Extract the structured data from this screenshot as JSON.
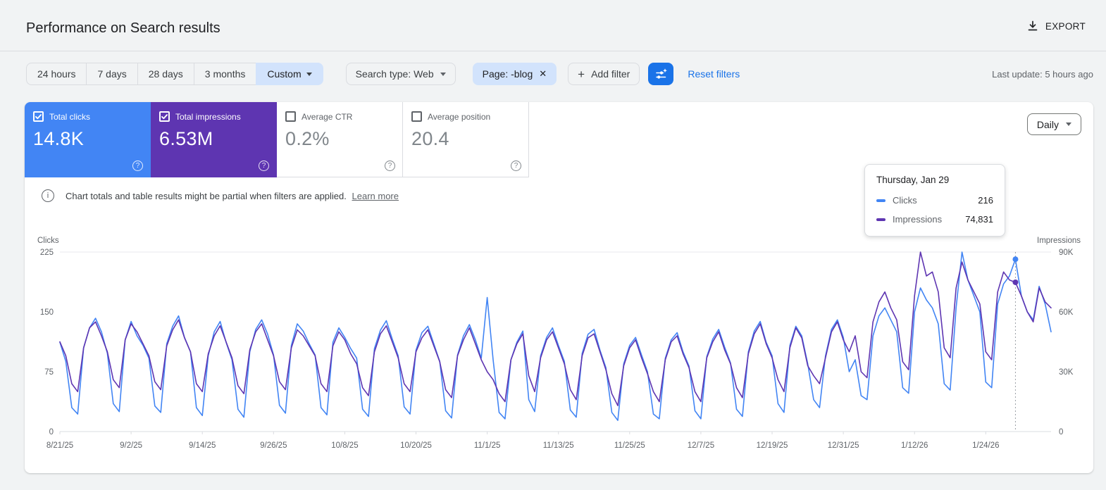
{
  "page": {
    "title": "Performance on Search results",
    "export_label": "EXPORT",
    "last_update": "Last update: 5 hours ago"
  },
  "icons": {
    "help": "?",
    "info": "i",
    "close": "✕",
    "plus": "+"
  },
  "filters": {
    "ranges": [
      {
        "label": "24 hours",
        "selected": false
      },
      {
        "label": "7 days",
        "selected": false
      },
      {
        "label": "28 days",
        "selected": false
      },
      {
        "label": "3 months",
        "selected": false
      },
      {
        "label": "Custom",
        "selected": true
      }
    ],
    "search_type": "Search type: Web",
    "page_filter": "Page: -blog",
    "add_filter": "Add filter",
    "reset": "Reset filters"
  },
  "metrics": {
    "granularity": "Daily",
    "cards": [
      {
        "label": "Total clicks",
        "value": "14.8K",
        "checked": true,
        "color": "#4285f4"
      },
      {
        "label": "Total impressions",
        "value": "6.53M",
        "checked": true,
        "color": "#5e35b1"
      },
      {
        "label": "Average CTR",
        "value": "0.2%",
        "checked": false
      },
      {
        "label": "Average position",
        "value": "20.4",
        "checked": false
      }
    ]
  },
  "notice": {
    "text": "Chart totals and table results might be partial when filters are applied.",
    "link": "Learn more"
  },
  "tooltip": {
    "title": "Thursday, Jan 29",
    "rows": [
      {
        "label": "Clicks",
        "value": "216",
        "color": "#4285f4"
      },
      {
        "label": "Impressions",
        "value": "74,831",
        "color": "#5e35b1"
      }
    ]
  },
  "chart_data": {
    "type": "line",
    "frequency": "daily",
    "x_tick_labels": [
      "8/21/25",
      "9/2/25",
      "9/14/25",
      "9/26/25",
      "10/8/25",
      "10/20/25",
      "11/1/25",
      "11/13/25",
      "11/25/25",
      "12/7/25",
      "12/19/25",
      "12/31/25",
      "1/12/26",
      "1/24/26"
    ],
    "x_tick_every": 12,
    "y_left": {
      "label": "Clicks",
      "max": 225,
      "ticks": [
        0,
        75,
        150,
        225
      ]
    },
    "y_right": {
      "label": "Impressions",
      "max": 90000,
      "ticks": [
        0,
        30000,
        60000,
        90000
      ],
      "tick_labels": [
        "0",
        "30K",
        "60K",
        "90K"
      ]
    },
    "legend": "off",
    "grid": "top-and-baseline-only",
    "highlight": {
      "index": 161,
      "label": "Thursday, Jan 29",
      "clicks": 216,
      "impressions": 74831
    },
    "series": [
      {
        "name": "Clicks",
        "axis": "left",
        "color": "#4285f4",
        "values": [
          112,
          88,
          30,
          22,
          105,
          130,
          142,
          125,
          98,
          35,
          25,
          115,
          138,
          120,
          108,
          92,
          32,
          24,
          110,
          132,
          145,
          118,
          100,
          30,
          20,
          95,
          125,
          138,
          112,
          90,
          28,
          18,
          100,
          128,
          140,
          122,
          96,
          33,
          23,
          108,
          135,
          126,
          110,
          96,
          30,
          21,
          112,
          130,
          118,
          104,
          92,
          28,
          19,
          104,
          127,
          139,
          116,
          95,
          31,
          22,
          102,
          124,
          132,
          110,
          88,
          26,
          17,
          96,
          120,
          134,
          115,
          92,
          168,
          90,
          24,
          16,
          90,
          112,
          126,
          40,
          25,
          95,
          118,
          130,
          108,
          88,
          27,
          18,
          98,
          122,
          128,
          102,
          80,
          24,
          14,
          85,
          108,
          118,
          96,
          75,
          22,
          16,
          92,
          115,
          124,
          100,
          82,
          26,
          16,
          94,
          116,
          128,
          106,
          86,
          28,
          19,
          100,
          126,
          138,
          112,
          95,
          35,
          24,
          108,
          132,
          120,
          85,
          40,
          30,
          95,
          128,
          140,
          118,
          75,
          90,
          45,
          40,
          120,
          145,
          155,
          140,
          125,
          55,
          48,
          150,
          180,
          165,
          155,
          135,
          60,
          52,
          155,
          225,
          190,
          170,
          150,
          62,
          55,
          160,
          185,
          195,
          216,
          170,
          150,
          140,
          182,
          160,
          125
        ]
      },
      {
        "name": "Impressions",
        "axis": "right",
        "color": "#5e35b1",
        "values": [
          45000,
          38000,
          24000,
          20000,
          42000,
          52000,
          55000,
          48000,
          40000,
          26000,
          22000,
          46000,
          54000,
          50000,
          44000,
          38000,
          25000,
          21000,
          43000,
          51000,
          56000,
          47000,
          40000,
          24000,
          20000,
          39000,
          48000,
          53000,
          45000,
          37000,
          23000,
          19000,
          41000,
          50000,
          54000,
          46000,
          38000,
          25000,
          21000,
          42000,
          51000,
          48000,
          43000,
          38000,
          24000,
          20000,
          43000,
          50000,
          46000,
          39000,
          34000,
          22000,
          18000,
          40000,
          49000,
          53000,
          45000,
          37000,
          24000,
          20000,
          40000,
          47000,
          51000,
          43000,
          35000,
          21000,
          17000,
          38000,
          46000,
          52000,
          44000,
          36000,
          30000,
          26000,
          19000,
          15000,
          36000,
          44000,
          49000,
          28000,
          20000,
          37000,
          46000,
          50000,
          42000,
          34000,
          21000,
          16000,
          38000,
          47000,
          49000,
          40000,
          31000,
          19000,
          13000,
          33000,
          42000,
          46000,
          37000,
          29000,
          20000,
          15000,
          36000,
          45000,
          48000,
          39000,
          32000,
          20000,
          15000,
          37000,
          45000,
          50000,
          41000,
          34000,
          22000,
          17000,
          39000,
          49000,
          54000,
          44000,
          37000,
          26000,
          20000,
          42000,
          52000,
          47000,
          33000,
          28000,
          24000,
          37000,
          50000,
          55000,
          46000,
          40000,
          48000,
          30000,
          27000,
          55000,
          65000,
          70000,
          62000,
          56000,
          35000,
          31000,
          68000,
          90000,
          78000,
          80000,
          70000,
          42000,
          37000,
          72000,
          85000,
          76000,
          70000,
          64000,
          40000,
          36000,
          70000,
          80000,
          76000,
          74831,
          68000,
          60000,
          55000,
          72000,
          65000,
          62000
        ]
      }
    ]
  }
}
